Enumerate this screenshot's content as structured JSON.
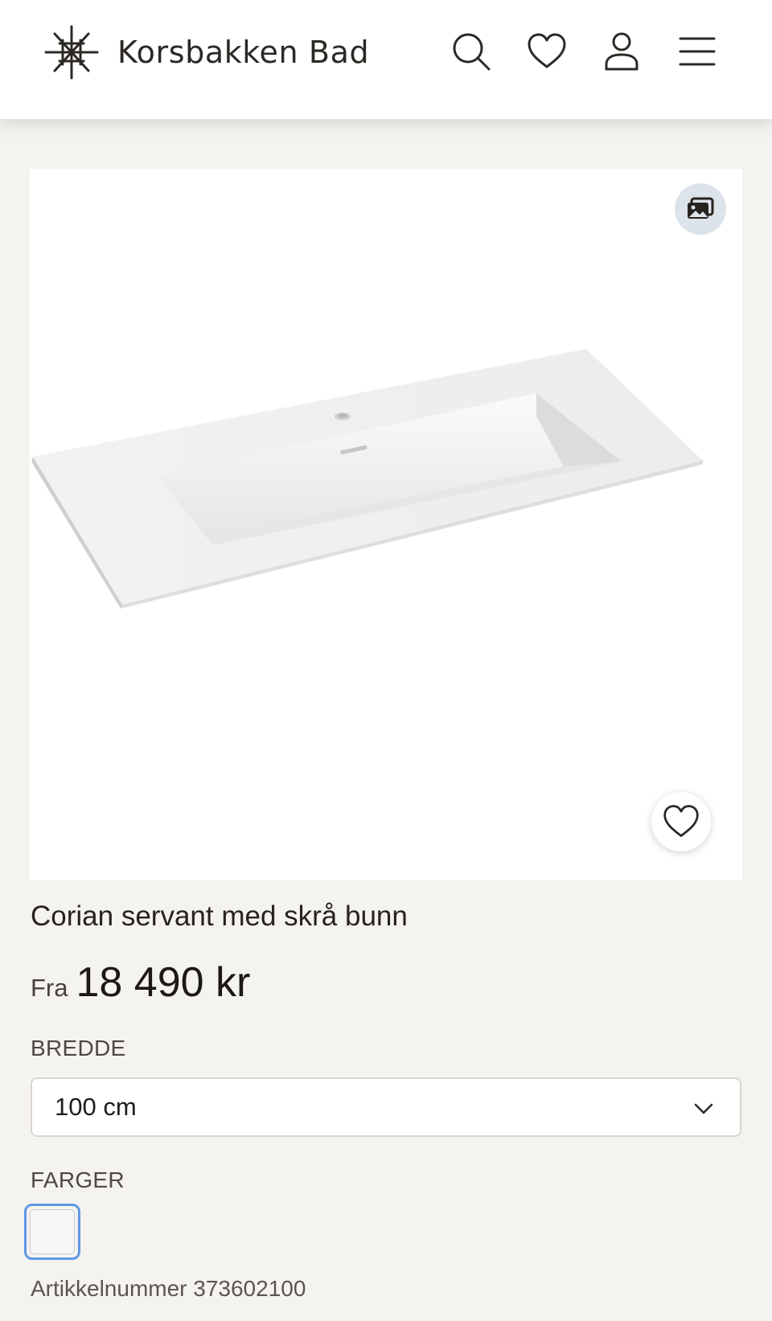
{
  "header": {
    "brand": "Korsbakken Bad",
    "icons": [
      "search-icon",
      "heart-icon",
      "user-icon",
      "menu-icon"
    ]
  },
  "product": {
    "title": "Corian servant med skrå bunn",
    "price_prefix": "Fra",
    "price": "18 490 kr",
    "width_label": "BREDDE",
    "width_selected": "100 cm",
    "colors_label": "FARGER",
    "color_swatches": [
      {
        "color": "#f7f7f6",
        "selected": true
      }
    ],
    "sku_text": "Artikkelnummer 373602100"
  },
  "colors": {
    "background": "#f5f3ef",
    "header": "#ffffff",
    "swatch_focus": "#5f98e6",
    "gallery_button": "#dde3ea"
  }
}
